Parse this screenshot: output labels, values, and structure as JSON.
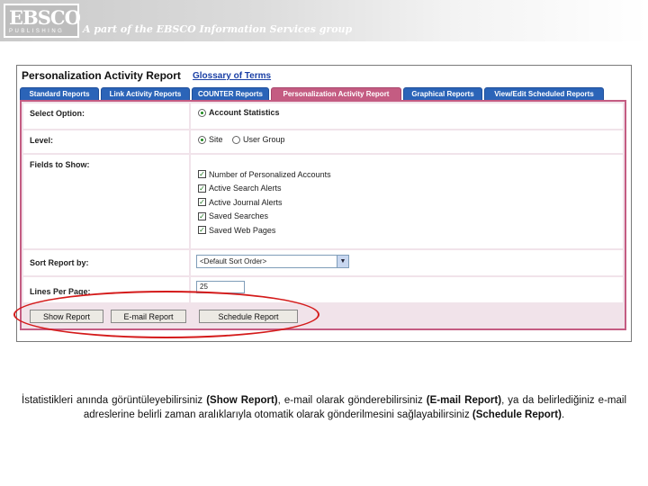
{
  "banner": {
    "logo": "EBSCO",
    "logo_sub": "PUBLISHING",
    "tagline": "A part of the EBSCO Information Services group"
  },
  "report": {
    "title": "Personalization Activity Report",
    "glossary_link": "Glossary of Terms"
  },
  "tabs": [
    {
      "label": "Standard Reports",
      "active": false
    },
    {
      "label": "Link Activity Reports",
      "active": false
    },
    {
      "label": "COUNTER Reports",
      "active": false
    },
    {
      "label": "Personalization Activity Report",
      "active": true
    },
    {
      "label": "Graphical Reports",
      "active": false
    },
    {
      "label": "View/Edit Scheduled Reports",
      "active": false
    }
  ],
  "form": {
    "select_option": {
      "label": "Select Option:",
      "value": "Account Statistics"
    },
    "level": {
      "label": "Level:",
      "options": [
        "Site",
        "User Group"
      ],
      "selected": "Site"
    },
    "fields": {
      "label": "Fields to Show:",
      "items": [
        {
          "label": "Number of Personalized Accounts",
          "checked": true
        },
        {
          "label": "Active Search Alerts",
          "checked": true
        },
        {
          "label": "Active Journal Alerts",
          "checked": true
        },
        {
          "label": "Saved Searches",
          "checked": true
        },
        {
          "label": "Saved Web Pages",
          "checked": true
        }
      ]
    },
    "sort": {
      "label": "Sort Report by:",
      "value": "<Default Sort Order>"
    },
    "lines": {
      "label": "Lines Per Page:",
      "value": "25"
    }
  },
  "buttons": {
    "show": "Show Report",
    "email": "E-mail Report",
    "schedule": "Schedule Report"
  },
  "caption": {
    "part1": "İstatistikleri anında görüntüleyebilirsiniz ",
    "bold1": "(Show Report)",
    "part2": ", e-mail olarak gönderebilirsiniz ",
    "bold2": "(E-mail Report)",
    "part3": ", ya da belirlediğiniz e-mail adreslerine belirli zaman aralıklarıyla otomatik olarak gönderilmesini sağlayabilirsiniz ",
    "bold3": "(Schedule Report)",
    "part4": "."
  },
  "colors": {
    "tab_blue": "#2b64b8",
    "tab_active": "#c45c82",
    "highlight_oval": "#d41a1a"
  }
}
